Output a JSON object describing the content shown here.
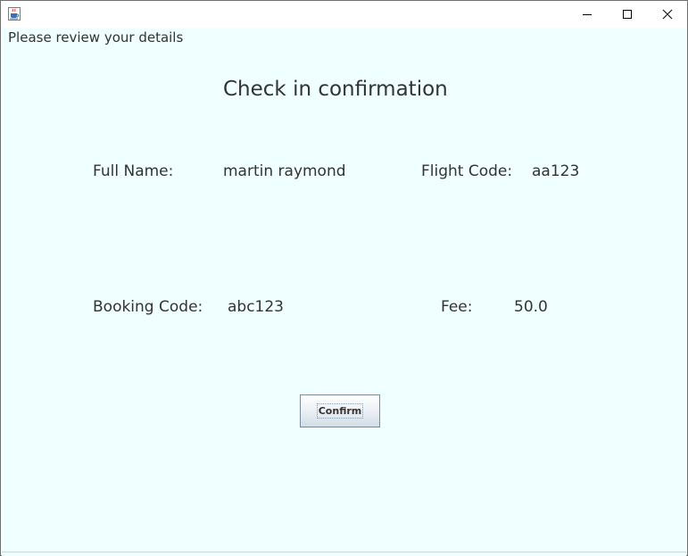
{
  "window": {
    "icon": "java-cup-icon",
    "controls": [
      "minimize-icon",
      "maximize-icon",
      "close-icon"
    ]
  },
  "header": {
    "text": "Please review your details"
  },
  "main": {
    "title": "Check in confirmation",
    "full_name_label": "Full Name:",
    "full_name_value": "martin raymond",
    "flight_code_label": "Flight Code:",
    "flight_code_value": "aa123",
    "booking_code_label": "Booking Code:",
    "booking_code_value": "abc123",
    "fee_label": "Fee:",
    "fee_value": "50.0",
    "confirm_label": "Confirm"
  },
  "colors": {
    "background": "#f0ffff",
    "text": "#333333",
    "button_border": "#7a8a99"
  }
}
